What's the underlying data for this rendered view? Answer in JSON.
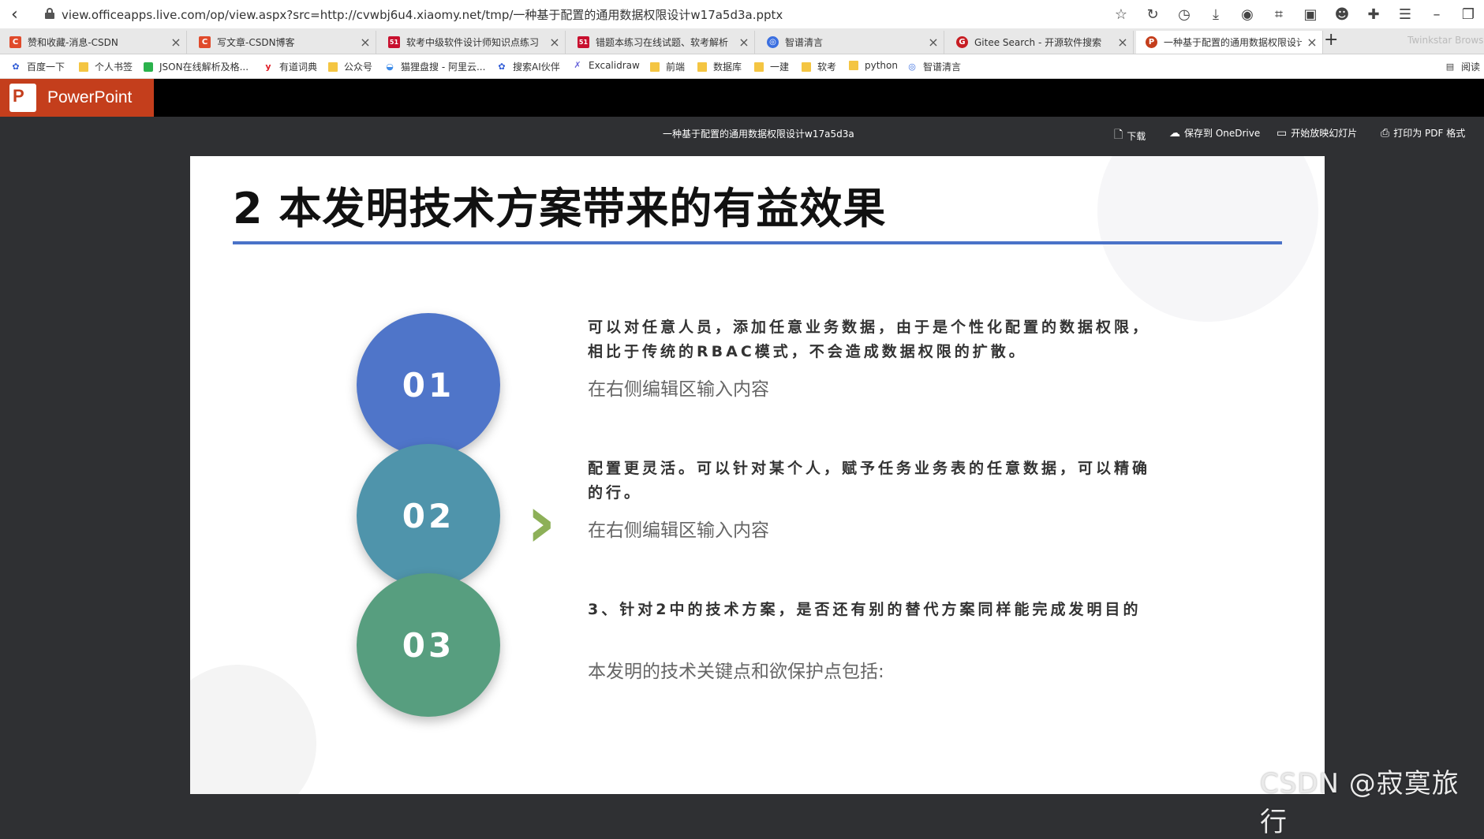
{
  "browser": {
    "url": "view.officeapps.live.com/op/view.aspx?src=http://cvwbj6u4.xiaomy.net/tmp/一种基于配置的通用数据权限设计w17a5d3a.pptx",
    "tabs": [
      {
        "title": "赞和收藏-消息-CSDN",
        "icon_color": "#e04a2b",
        "icon_text": "C"
      },
      {
        "title": "写文章-CSDN博客",
        "icon_color": "#e04a2b",
        "icon_text": "C"
      },
      {
        "title": "软考中级软件设计师知识点练习",
        "icon_color": "#c8102e",
        "icon_text": "51"
      },
      {
        "title": "错题本练习在线试题、软考解析",
        "icon_color": "#c8102e",
        "icon_text": "51"
      },
      {
        "title": "智谱清言",
        "icon_color": "#3b6fe0",
        "icon_text": "◎"
      },
      {
        "title": "Gitee Search - 开源软件搜索",
        "icon_color": "#c71d23",
        "icon_text": "G"
      },
      {
        "title": "一种基于配置的通用数据权限设计",
        "icon_color": "#c43e1c",
        "icon_text": "P"
      }
    ],
    "tab_overflow": "Twinkstar Brows",
    "bookmarks": [
      "百度一下",
      "个人书签",
      "JSON在线解析及格...",
      "有道词典",
      "公众号",
      "猫狸盘搜 - 阿里云...",
      "搜索AI伙伴",
      "Excalidraw",
      "前端",
      "数据库",
      "一建",
      "软考",
      "python",
      "智谱清言"
    ],
    "reading_mode": "阅读"
  },
  "app": {
    "name": "PowerPoint",
    "brand_color": "#c43e1c",
    "doc_title": "一种基于配置的通用数据权限设计w17a5d3a",
    "commands": {
      "download": "下载",
      "save_onedrive": "保存到 OneDrive",
      "slideshow": "开始放映幻灯片",
      "print_pdf": "打印为 PDF 格式"
    }
  },
  "slide": {
    "title": "2 本发明技术方案带来的有益效果",
    "accent_line_color": "#4a72c8",
    "items": [
      {
        "num": "01",
        "color": "#4f75c9",
        "head": "可以对任意人员，添加任意业务数据，由于是个性化配置的数据权限，相比于传统的RBAC模式，不会造成数据权限的扩散。",
        "sub": "在右侧编辑区输入内容"
      },
      {
        "num": "02",
        "color": "#4f94ab",
        "head": "配置更灵活。可以针对某个人，赋予任务业务表的任意数据，可以精确的行。",
        "sub": "在右侧编辑区输入内容"
      },
      {
        "num": "03",
        "color": "#579e7f",
        "head": "3、针对2中的技术方案，是否还有别的替代方案同样能完成发明目的",
        "sub": "本发明的技术关键点和欲保护点包括:"
      }
    ],
    "arrow": "›"
  },
  "watermark": "CSDN @寂寞旅行"
}
